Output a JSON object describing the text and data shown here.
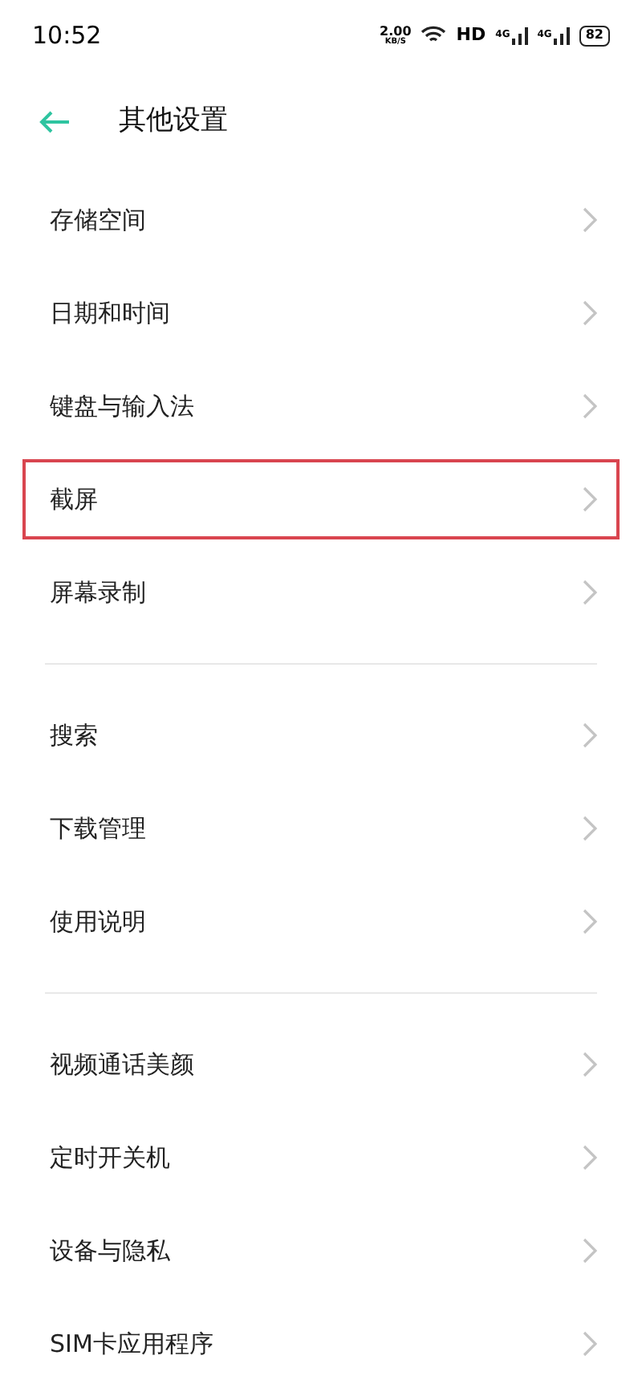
{
  "status_bar": {
    "time": "10:52",
    "speed_value": "2.00",
    "speed_unit": "KB/S",
    "hd": "HD",
    "networks": [
      "4G",
      "4G"
    ],
    "battery": "82"
  },
  "header": {
    "title": "其他设置"
  },
  "groups": [
    {
      "items": [
        {
          "label": "存储空间",
          "highlighted": false
        },
        {
          "label": "日期和时间",
          "highlighted": false
        },
        {
          "label": "键盘与输入法",
          "highlighted": false
        },
        {
          "label": "截屏",
          "highlighted": true
        },
        {
          "label": "屏幕录制",
          "highlighted": false
        }
      ]
    },
    {
      "items": [
        {
          "label": "搜索",
          "highlighted": false
        },
        {
          "label": "下载管理",
          "highlighted": false
        },
        {
          "label": "使用说明",
          "highlighted": false
        }
      ]
    },
    {
      "items": [
        {
          "label": "视频通话美颜",
          "highlighted": false
        },
        {
          "label": "定时开关机",
          "highlighted": false
        },
        {
          "label": "设备与隐私",
          "highlighted": false
        },
        {
          "label": "SIM卡应用程序",
          "highlighted": false
        }
      ]
    }
  ]
}
